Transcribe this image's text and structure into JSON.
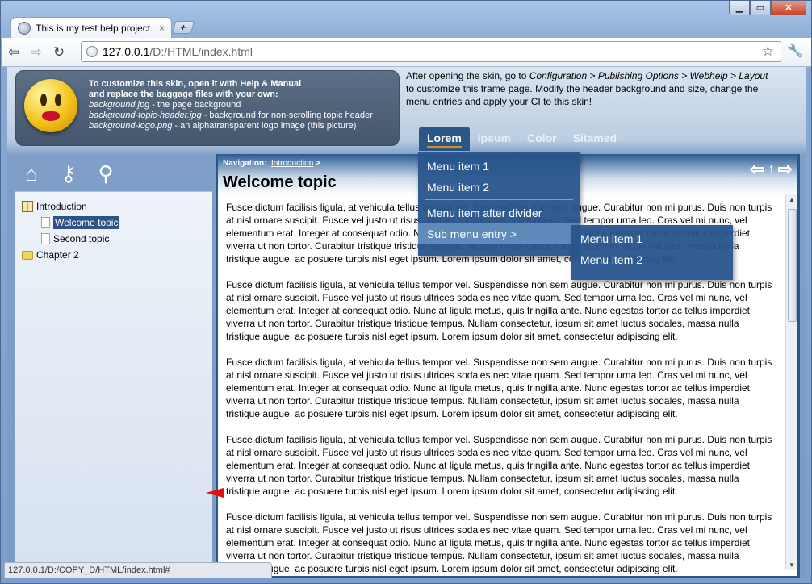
{
  "browser": {
    "tab_title": "This is my test help project",
    "tab_close": "×",
    "new_tab": "+",
    "url_host": "127.0.0.1",
    "url_path": "/D:/HTML/index.html",
    "status_url": "127.0.0.1/D:/COPY_D/HTML/index.html#",
    "icons": [
      "back-icon",
      "forward-icon",
      "reload-icon",
      "star-icon",
      "wrench-icon"
    ]
  },
  "header": {
    "line1": "To customize this skin, open it with Help & Manual",
    "line2": "and replace the baggage files with your own:",
    "files": [
      {
        "name": "background.jpg",
        "desc": " - the page background"
      },
      {
        "name": "background-topic-header.jpg",
        "desc": " - background for non-scrolling topic header"
      },
      {
        "name": "background-logo.png",
        "desc": " - an alphatransparent logo image (this picture)"
      }
    ],
    "config_text_a": "After opening the skin, go to ",
    "config_path": "Configuration > Publishing Options > Webhelp > Layout",
    "config_text_b": " to customize this frame page. Modify the header background and size, change the menu entries and apply your CI to this skin!"
  },
  "menu": {
    "items": [
      "Lorem",
      "Ipsum",
      "Color",
      "Sitamed"
    ],
    "dropdown": [
      "Menu item 1",
      "Menu item 2",
      "Menu item after divider",
      "Sub menu entry >"
    ],
    "submenu": [
      "Menu item 1",
      "Menu item 2"
    ]
  },
  "toc": {
    "items": [
      {
        "label": "Introduction",
        "icon": "book-icon"
      },
      {
        "label": "Welcome topic",
        "icon": "page-icon"
      },
      {
        "label": "Second topic",
        "icon": "page-icon"
      },
      {
        "label": "Chapter 2",
        "icon": "folder-icon"
      }
    ]
  },
  "topic": {
    "nav_label": "Navigation:",
    "nav_link": "Introduction",
    "nav_sep": " >",
    "title": "Welcome topic",
    "paragraph": "Fusce dictum facilisis ligula, at vehicula tellus tempor vel. Suspendisse non sem augue. Curabitur non mi purus. Duis non turpis at nisl ornare suscipit. Fusce vel justo ut risus ultrices sodales nec vitae quam. Sed tempor urna leo. Cras vel mi nunc, vel elementum erat. Integer at consequat odio. Nunc at ligula metus, quis fringilla ante. Nunc egestas tortor ac tellus imperdiet viverra ut non tortor. Curabitur tristique tristique tempus. Nullam consectetur, ipsum sit amet luctus sodales, massa nulla tristique augue, ac posuere turpis nisl eget ipsum. Lorem ipsum dolor sit amet, consectetur adipiscing elit."
  }
}
